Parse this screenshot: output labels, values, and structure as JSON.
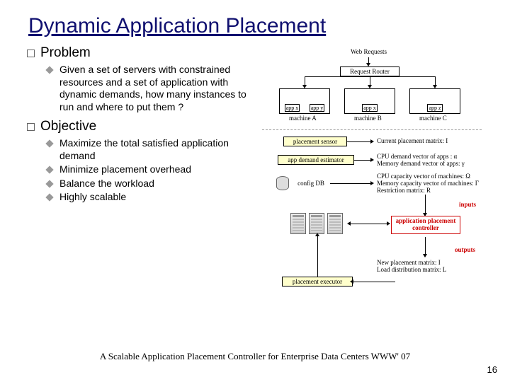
{
  "title": "Dynamic Application Placement",
  "sections": [
    {
      "heading": "Problem",
      "items": [
        "Given a set of servers with constrained resources and a set of application with dynamic demands, how many instances to run and where to put them ?"
      ]
    },
    {
      "heading": "Objective",
      "items": [
        "Maximize the total satisfied application demand",
        "Minimize placement overhead",
        "Balance the workload",
        "Highly scalable"
      ]
    }
  ],
  "diagram": {
    "top_label": "Web Requests",
    "request_router": "Request Router",
    "machines": [
      {
        "label": "machine A",
        "apps": [
          "app x",
          "app y"
        ]
      },
      {
        "label": "machine B",
        "apps": [
          "app x"
        ]
      },
      {
        "label": "machine C",
        "apps": [
          "app z"
        ]
      }
    ],
    "placement_sensor": "placement sensor",
    "app_demand_estimator": "app demand estimator",
    "config_db": "config DB",
    "controller": "application placement controller",
    "placement_executor": "placement executor",
    "side_label_inputs": "inputs",
    "side_label_outputs": "outputs",
    "info_sensor": "Current placement matrix: I",
    "info_demand1": "CPU demand vector of apps : α",
    "info_demand2": "Memory demand vector of apps: γ",
    "info_config1": "CPU capacity vector of machines: Ω",
    "info_config2": "Memory capacity vector of machines: Γ",
    "info_config3": "Restriction matrix: R",
    "info_out1": "New placement matrix: I",
    "info_out2": "Load distribution matrix: L"
  },
  "citation": "A Scalable Application Placement Controller for Enterprise Data Centers  WWW' 07",
  "page": "16"
}
